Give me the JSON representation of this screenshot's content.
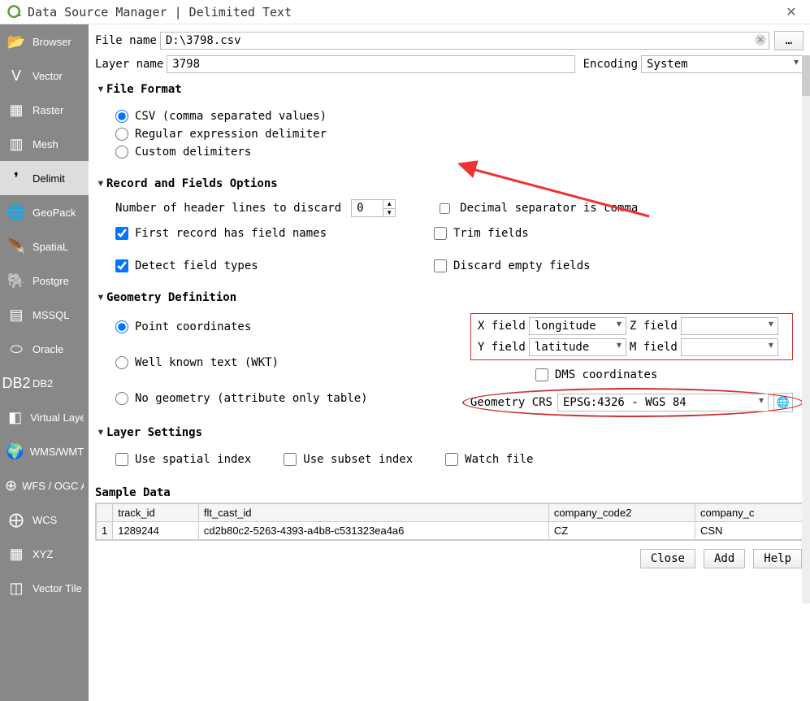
{
  "window": {
    "title": "Data Source Manager | Delimited Text"
  },
  "sidebar": {
    "items": [
      {
        "label": "Browser",
        "icon": "📂"
      },
      {
        "label": "Vector",
        "icon": "V"
      },
      {
        "label": "Raster",
        "icon": "▦"
      },
      {
        "label": "Mesh",
        "icon": "▥"
      },
      {
        "label": "Delimit",
        "icon": "❜"
      },
      {
        "label": "GeoPack",
        "icon": "🌐"
      },
      {
        "label": "SpatiaL",
        "icon": "🪶"
      },
      {
        "label": "Postgre",
        "icon": "🐘"
      },
      {
        "label": "MSSQL",
        "icon": "▤"
      },
      {
        "label": "Oracle",
        "icon": "⬭"
      },
      {
        "label": "DB2",
        "icon": "DB2"
      },
      {
        "label": "Virtual Layer",
        "icon": "◧"
      },
      {
        "label": "WMS/WMTS",
        "icon": "🌍"
      },
      {
        "label": "WFS / OGC API - Feature",
        "icon": "⊕"
      },
      {
        "label": "WCS",
        "icon": "⨁"
      },
      {
        "label": "XYZ",
        "icon": "▦"
      },
      {
        "label": "Vector Tile",
        "icon": "◫"
      }
    ],
    "active_index": 4
  },
  "top": {
    "file_name_label": "File name",
    "file_name_value": "D:\\3798.csv",
    "browse_label": "…",
    "layer_name_label": "Layer name",
    "layer_name_value": "3798",
    "encoding_label": "Encoding",
    "encoding_value": "System"
  },
  "file_format": {
    "title": "File Format",
    "csv": "CSV (comma separated values)",
    "regex": "Regular expression delimiter",
    "custom": "Custom delimiters",
    "selected": "csv"
  },
  "records": {
    "title": "Record and Fields Options",
    "discard_label": "Number of header lines to discard",
    "discard_value": "0",
    "decimal_comma": "Decimal separator is comma",
    "first_record": "First record has field names",
    "trim": "Trim fields",
    "detect": "Detect field types",
    "discard_empty": "Discard empty fields",
    "checked_first_record": true,
    "checked_detect": true
  },
  "geometry": {
    "title": "Geometry Definition",
    "point": "Point coordinates",
    "wkt": "Well known text (WKT)",
    "none": "No geometry (attribute only table)",
    "selected": "point",
    "xfield_label": "X field",
    "xfield_value": "longitude",
    "zfield_label": "Z field",
    "zfield_value": "",
    "yfield_label": "Y field",
    "yfield_value": "latitude",
    "mfield_label": "M field",
    "mfield_value": "",
    "dms": "DMS coordinates",
    "crs_label": "Geometry CRS",
    "crs_value": "EPSG:4326 - WGS 84"
  },
  "layer_settings": {
    "title": "Layer Settings",
    "spatial": "Use spatial index",
    "subset": "Use subset index",
    "watch": "Watch file"
  },
  "sample": {
    "title": "Sample Data",
    "columns": [
      "track_id",
      "flt_cast_id",
      "company_code2",
      "company_c"
    ],
    "rows": [
      [
        "1",
        "1289244",
        "cd2b80c2-5263-4393-a4b8-c531323ea4a6",
        "CZ",
        "CSN"
      ]
    ]
  },
  "footer": {
    "close": "Close",
    "add": "Add",
    "help": "Help"
  }
}
